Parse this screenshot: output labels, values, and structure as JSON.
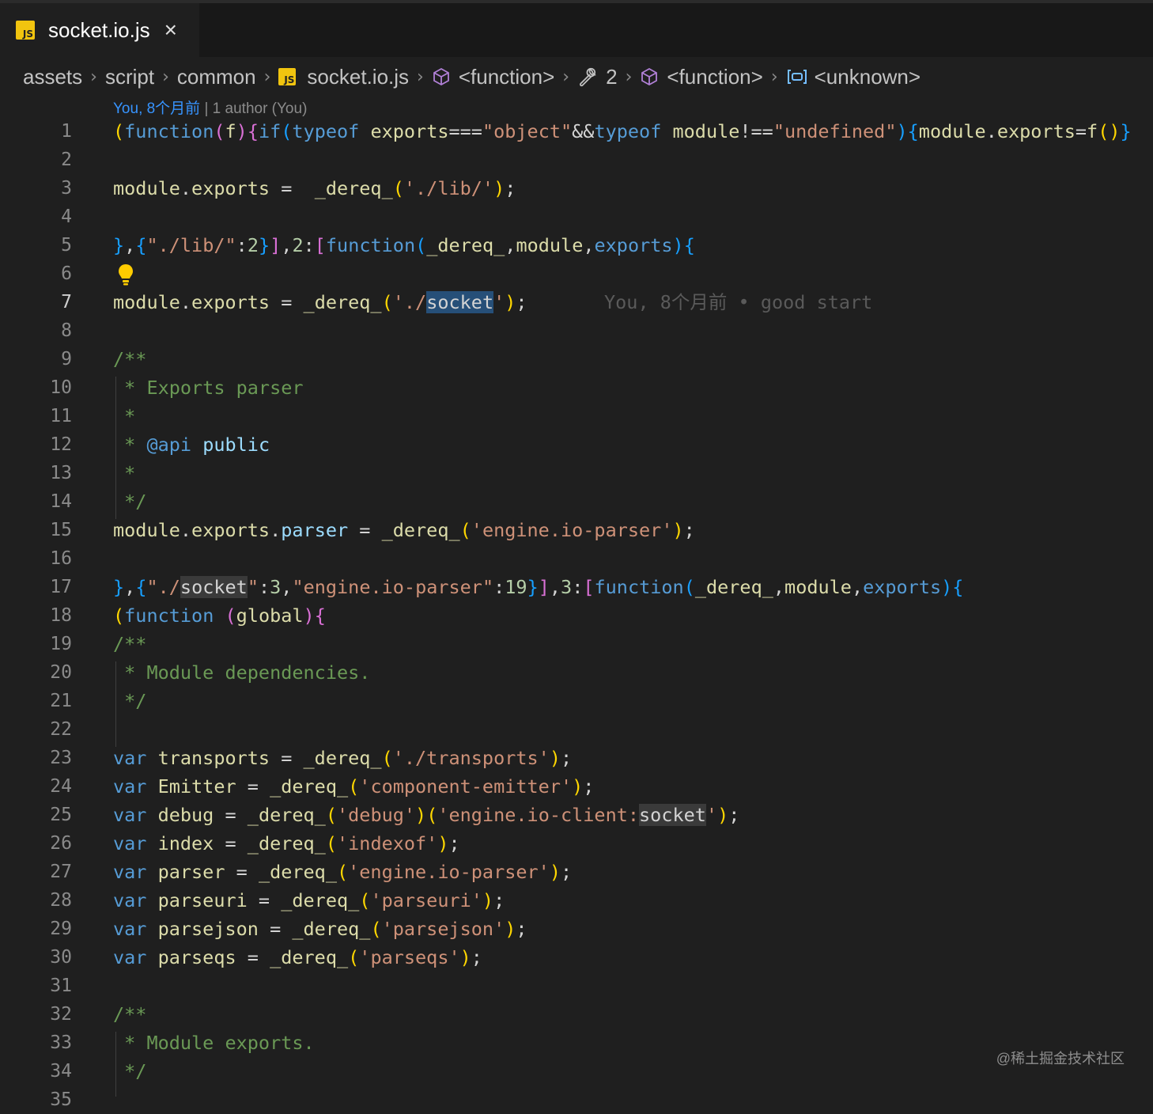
{
  "tab": {
    "title": "socket.io.js",
    "close": "×",
    "icon_text": "JS"
  },
  "breadcrumb": {
    "items": [
      "assets",
      "script",
      "common",
      "socket.io.js",
      "<function>",
      "2",
      "<function>",
      "<unknown>"
    ],
    "separator": "›"
  },
  "codelens": {
    "blame": "You, 8个月前",
    "authors": " | 1 author (You)"
  },
  "inline_blame": "You, 8个月前 • good start",
  "line_numbers": [
    "1",
    "2",
    "3",
    "4",
    "5",
    "6",
    "7",
    "8",
    "9",
    "10",
    "11",
    "12",
    "13",
    "14",
    "15",
    "16",
    "17",
    "18",
    "19",
    "20",
    "21",
    "22",
    "23",
    "24",
    "25",
    "26",
    "27",
    "28",
    "29",
    "30",
    "31",
    "32",
    "33",
    "34",
    "35"
  ],
  "active_line": 7,
  "code_lines": [
    [
      [
        "br1",
        "("
      ],
      [
        "kw",
        "function"
      ],
      [
        "br2",
        "("
      ],
      [
        "fn",
        "f"
      ],
      [
        "br2",
        ")"
      ],
      [
        "br2",
        "{"
      ],
      [
        "kw",
        "if"
      ],
      [
        "br3",
        "("
      ],
      [
        "kw",
        "typeof "
      ],
      [
        "fn",
        "exports"
      ],
      [
        "pl",
        "==="
      ],
      [
        "st",
        "\"object\""
      ],
      [
        "pl",
        "&&"
      ],
      [
        "kw",
        "typeof "
      ],
      [
        "fn",
        "module"
      ],
      [
        "pl",
        "!=="
      ],
      [
        "st",
        "\"undefined\""
      ],
      [
        "br3",
        ")"
      ],
      [
        "br3",
        "{"
      ],
      [
        "fn",
        "module"
      ],
      [
        "pl",
        "."
      ],
      [
        "fn",
        "exports"
      ],
      [
        "pl",
        "="
      ],
      [
        "fn",
        "f"
      ],
      [
        "br1",
        "()"
      ],
      [
        "br3",
        "}"
      ]
    ],
    [],
    [
      [
        "fn",
        "module"
      ],
      [
        "pl",
        "."
      ],
      [
        "fn",
        "exports"
      ],
      [
        "pl",
        " =  "
      ],
      [
        "fn",
        "_dereq_"
      ],
      [
        "br1",
        "("
      ],
      [
        "st",
        "'./lib/'"
      ],
      [
        "br1",
        ")"
      ],
      [
        "pl",
        ";"
      ]
    ],
    [],
    [
      [
        "br3",
        "}"
      ],
      [
        "pl",
        ","
      ],
      [
        "br3",
        "{"
      ],
      [
        "st",
        "\"./lib/\""
      ],
      [
        "pl",
        ":"
      ],
      [
        "nm",
        "2"
      ],
      [
        "br3",
        "}"
      ],
      [
        "br2",
        "]"
      ],
      [
        "pl",
        ","
      ],
      [
        "nm",
        "2"
      ],
      [
        "pl",
        ":"
      ],
      [
        "br2",
        "["
      ],
      [
        "kw",
        "function"
      ],
      [
        "br3",
        "("
      ],
      [
        "fn",
        "_dereq_"
      ],
      [
        "pl",
        ","
      ],
      [
        "fn",
        "module"
      ],
      [
        "pl",
        ","
      ],
      [
        "kw",
        "exports"
      ],
      [
        "br3",
        ")"
      ],
      [
        "br3",
        "{"
      ]
    ],
    [],
    [
      [
        "fn",
        "module"
      ],
      [
        "pl",
        "."
      ],
      [
        "fn",
        "exports"
      ],
      [
        "pl",
        " = "
      ],
      [
        "fn",
        "_dereq_"
      ],
      [
        "br1",
        "("
      ],
      [
        "st",
        "'./"
      ],
      [
        "hl",
        "socket"
      ],
      [
        "st",
        "'"
      ],
      [
        "br1",
        ")"
      ],
      [
        "pl",
        ";"
      ]
    ],
    [],
    [
      [
        "cm",
        "/**"
      ]
    ],
    [
      [
        "cm",
        " * Exports parser"
      ]
    ],
    [
      [
        "cm",
        " *"
      ]
    ],
    [
      [
        "cm",
        " * "
      ],
      [
        "kw",
        "@api "
      ],
      [
        "id",
        "public"
      ]
    ],
    [
      [
        "cm",
        " *"
      ]
    ],
    [
      [
        "cm",
        " */"
      ]
    ],
    [
      [
        "fn",
        "module"
      ],
      [
        "pl",
        "."
      ],
      [
        "fn",
        "exports"
      ],
      [
        "pl",
        "."
      ],
      [
        "id",
        "parser"
      ],
      [
        "pl",
        " = "
      ],
      [
        "fn",
        "_dereq_"
      ],
      [
        "br1",
        "("
      ],
      [
        "st",
        "'engine.io-parser'"
      ],
      [
        "br1",
        ")"
      ],
      [
        "pl",
        ";"
      ]
    ],
    [],
    [
      [
        "br3",
        "}"
      ],
      [
        "pl",
        ","
      ],
      [
        "br3",
        "{"
      ],
      [
        "st",
        "\"./"
      ],
      [
        "hl2",
        "socket"
      ],
      [
        "st",
        "\""
      ],
      [
        "pl",
        ":"
      ],
      [
        "nm",
        "3"
      ],
      [
        "pl",
        ","
      ],
      [
        "st",
        "\"engine.io-parser\""
      ],
      [
        "pl",
        ":"
      ],
      [
        "nm",
        "19"
      ],
      [
        "br3",
        "}"
      ],
      [
        "br2",
        "]"
      ],
      [
        "pl",
        ","
      ],
      [
        "nm",
        "3"
      ],
      [
        "pl",
        ":"
      ],
      [
        "br2",
        "["
      ],
      [
        "kw",
        "function"
      ],
      [
        "br3",
        "("
      ],
      [
        "fn",
        "_dereq_"
      ],
      [
        "pl",
        ","
      ],
      [
        "fn",
        "module"
      ],
      [
        "pl",
        ","
      ],
      [
        "kw",
        "exports"
      ],
      [
        "br3",
        ")"
      ],
      [
        "br3",
        "{"
      ]
    ],
    [
      [
        "br1",
        "("
      ],
      [
        "kw",
        "function "
      ],
      [
        "br2",
        "("
      ],
      [
        "fn",
        "global"
      ],
      [
        "br2",
        ")"
      ],
      [
        "br2",
        "{"
      ]
    ],
    [
      [
        "cm",
        "/**"
      ]
    ],
    [
      [
        "cm",
        " * Module dependencies."
      ]
    ],
    [
      [
        "cm",
        " */"
      ]
    ],
    [],
    [
      [
        "kw",
        "var "
      ],
      [
        "fn",
        "transports"
      ],
      [
        "pl",
        " = "
      ],
      [
        "fn",
        "_dereq_"
      ],
      [
        "br1",
        "("
      ],
      [
        "st",
        "'./transports'"
      ],
      [
        "br1",
        ")"
      ],
      [
        "pl",
        ";"
      ]
    ],
    [
      [
        "kw",
        "var "
      ],
      [
        "fn",
        "Emitter"
      ],
      [
        "pl",
        " = "
      ],
      [
        "fn",
        "_dereq_"
      ],
      [
        "br1",
        "("
      ],
      [
        "st",
        "'component-emitter'"
      ],
      [
        "br1",
        ")"
      ],
      [
        "pl",
        ";"
      ]
    ],
    [
      [
        "kw",
        "var "
      ],
      [
        "fn",
        "debug"
      ],
      [
        "pl",
        " = "
      ],
      [
        "fn",
        "_dereq_"
      ],
      [
        "br1",
        "("
      ],
      [
        "st",
        "'debug'"
      ],
      [
        "br1",
        ")"
      ],
      [
        "br1",
        "("
      ],
      [
        "st",
        "'engine.io-client:"
      ],
      [
        "hl2",
        "socket"
      ],
      [
        "st",
        "'"
      ],
      [
        "br1",
        ")"
      ],
      [
        "pl",
        ";"
      ]
    ],
    [
      [
        "kw",
        "var "
      ],
      [
        "fn",
        "index"
      ],
      [
        "pl",
        " = "
      ],
      [
        "fn",
        "_dereq_"
      ],
      [
        "br1",
        "("
      ],
      [
        "st",
        "'indexof'"
      ],
      [
        "br1",
        ")"
      ],
      [
        "pl",
        ";"
      ]
    ],
    [
      [
        "kw",
        "var "
      ],
      [
        "fn",
        "parser"
      ],
      [
        "pl",
        " = "
      ],
      [
        "fn",
        "_dereq_"
      ],
      [
        "br1",
        "("
      ],
      [
        "st",
        "'engine.io-parser'"
      ],
      [
        "br1",
        ")"
      ],
      [
        "pl",
        ";"
      ]
    ],
    [
      [
        "kw",
        "var "
      ],
      [
        "fn",
        "parseuri"
      ],
      [
        "pl",
        " = "
      ],
      [
        "fn",
        "_dereq_"
      ],
      [
        "br1",
        "("
      ],
      [
        "st",
        "'parseuri'"
      ],
      [
        "br1",
        ")"
      ],
      [
        "pl",
        ";"
      ]
    ],
    [
      [
        "kw",
        "var "
      ],
      [
        "fn",
        "parsejson"
      ],
      [
        "pl",
        " = "
      ],
      [
        "fn",
        "_dereq_"
      ],
      [
        "br1",
        "("
      ],
      [
        "st",
        "'parsejson'"
      ],
      [
        "br1",
        ")"
      ],
      [
        "pl",
        ";"
      ]
    ],
    [
      [
        "kw",
        "var "
      ],
      [
        "fn",
        "parseqs"
      ],
      [
        "pl",
        " = "
      ],
      [
        "fn",
        "_dereq_"
      ],
      [
        "br1",
        "("
      ],
      [
        "st",
        "'parseqs'"
      ],
      [
        "br1",
        ")"
      ],
      [
        "pl",
        ";"
      ]
    ],
    [],
    [
      [
        "cm",
        "/**"
      ]
    ],
    [
      [
        "cm",
        " * Module exports."
      ]
    ],
    [
      [
        "cm",
        " */"
      ]
    ],
    []
  ],
  "watermark": "@稀土掘金技术社区",
  "colors": {
    "background": "#1f1f1f",
    "keyword": "#569cd6",
    "string": "#ce9178",
    "function": "#dcdcaa",
    "comment": "#6a9955",
    "selection": "#264f78"
  }
}
